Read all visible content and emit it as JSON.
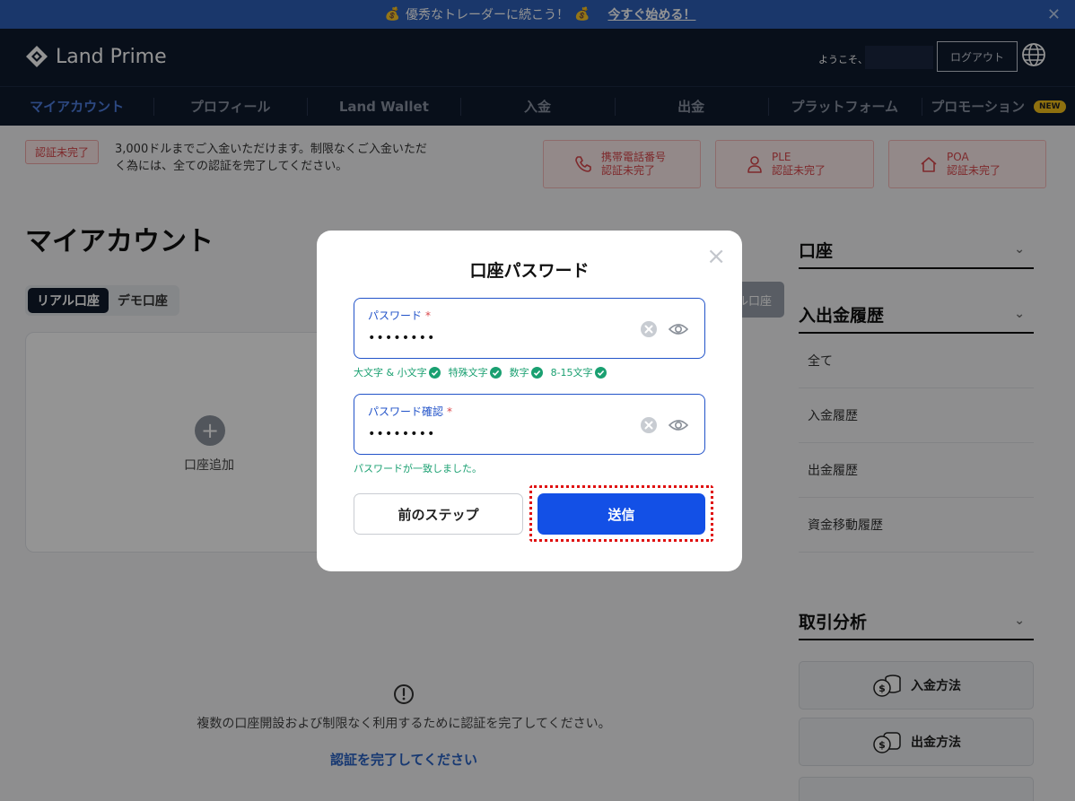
{
  "promo": {
    "text": "優秀なトレーダーに続こう！",
    "cta": "今すぐ始める！",
    "close": "✕"
  },
  "header": {
    "brand": "Land Prime",
    "welcome": "ようこそ、",
    "logout": "ログアウト"
  },
  "nav": {
    "items": [
      {
        "label": "マイアカウント"
      },
      {
        "label": "プロフィール"
      },
      {
        "label": "Land Wallet"
      },
      {
        "label": "入金"
      },
      {
        "label": "出金"
      },
      {
        "label": "プラットフォーム"
      },
      {
        "label": "プロモーション"
      }
    ],
    "new_badge": "NEW"
  },
  "verification": {
    "badge": "認証未完了",
    "message": "3,000ドルまでご入金いただけます。制限なくご入金いただく為には、全ての認証を完了してください。",
    "cards": [
      {
        "line1": "携帯電話番号",
        "line2": "認証未完了"
      },
      {
        "line1": "PLE",
        "line2": "認証未完了"
      },
      {
        "line1": "POA",
        "line2": "認証未完了"
      }
    ]
  },
  "main": {
    "title": "マイアカウント",
    "tabs": [
      {
        "label": "リアル口座"
      },
      {
        "label": "デモ口座"
      }
    ],
    "add_account": "口座追加",
    "partial_button": "ル口座",
    "notice": "複数の口座開設および制限なく利用するために認証を完了してください。",
    "notice_link": "認証を完了してください"
  },
  "sidebar": {
    "account_head": "口座",
    "history_head": "入出金履歴",
    "history_items": [
      {
        "label": "全て"
      },
      {
        "label": "入金履歴"
      },
      {
        "label": "出金履歴"
      },
      {
        "label": "資金移動履歴"
      }
    ],
    "analysis_head": "取引分析",
    "deposit_method": "入金方法",
    "withdraw_method": "出金方法"
  },
  "modal": {
    "title": "口座パスワード",
    "password_label": "パスワード",
    "password_value": "••••••••",
    "confirm_label": "パスワード確認",
    "confirm_value": "••••••••",
    "required_mark": "*",
    "rules": [
      {
        "label": "大文字 & 小文字"
      },
      {
        "label": "特殊文字"
      },
      {
        "label": "数字"
      },
      {
        "label": "8-15文字"
      }
    ],
    "match_message": "パスワードが一致しました。",
    "prev_button": "前のステップ",
    "submit_button": "送信",
    "close": "×"
  },
  "colors": {
    "accent": "#1350e6",
    "nav_bg": "#0e1a2e",
    "error": "#d9484c",
    "success": "#1aa071"
  }
}
